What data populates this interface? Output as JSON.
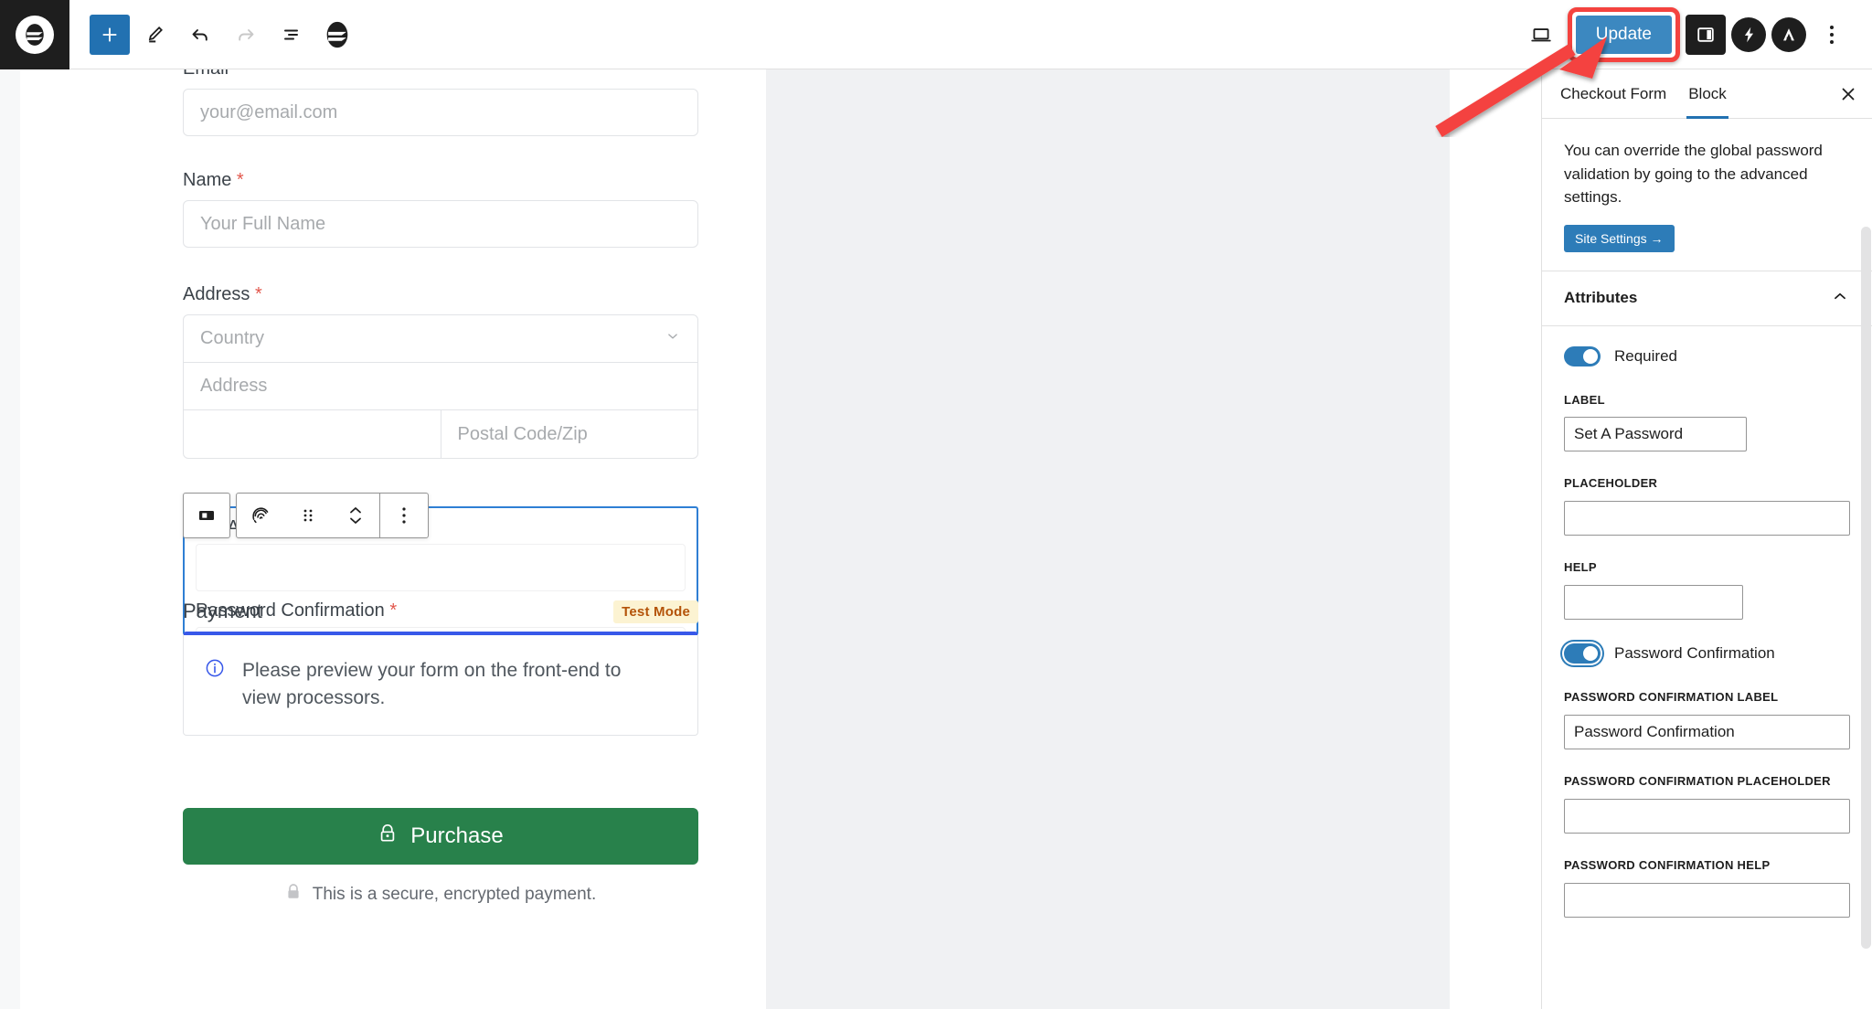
{
  "topbar": {
    "logo_icon": "wordpress-site-logo-icon",
    "buttons": [
      {
        "name": "add-block",
        "icon": "plus-icon",
        "label": ""
      },
      {
        "name": "tools",
        "icon": "pencil-icon",
        "label": ""
      },
      {
        "name": "undo",
        "icon": "undo-arrow-icon",
        "label": ""
      },
      {
        "name": "redo",
        "icon": "redo-arrow-icon",
        "label": ""
      },
      {
        "name": "list-view",
        "icon": "list-view-icon",
        "label": ""
      },
      {
        "name": "plugin-logo",
        "icon": "sureforms-logo-icon",
        "label": ""
      }
    ],
    "view_icon": "laptop-preview-icon",
    "update_label": "Update",
    "sidebar_toggle_icon": "settings-panel-icon",
    "plugin_icons": [
      "lightning-bolt-icon",
      "analytics-icon"
    ],
    "options_icon": "kebab-menu-icon"
  },
  "canvas": {
    "fields": [
      {
        "label": "Email",
        "required": false,
        "placeholder": "your@email.com"
      },
      {
        "label": "Name",
        "required": true,
        "placeholder": "Your Full Name"
      }
    ],
    "address": {
      "label": "Address",
      "required": true,
      "country_placeholder": "Country",
      "street_placeholder": "Address",
      "city_placeholder": "",
      "postal_placeholder": "Postal Code/Zip"
    },
    "block_toolbar": {
      "block_type_icon": "password-block-icon",
      "fingerprint_icon": "fingerprint-icon",
      "drag_icon": "drag-handle-icon",
      "movers_icon": "move-up-down-icon",
      "options_icon": "block-options-icon"
    },
    "selected_block": {
      "password_label": "Set A Password",
      "password_required": true,
      "confirm_label": "Password Confirmation",
      "confirm_required": true
    },
    "payment": {
      "title": "Payment",
      "badge": "Test Mode",
      "notice_icon": "info-circle-icon",
      "notice": "Please preview your form on the front-end to view processors."
    },
    "purchase": {
      "icon": "lock-icon",
      "label": "Purchase",
      "secure_icon": "padlock-icon",
      "secure_text": "This is a secure, encrypted payment."
    }
  },
  "sidebar": {
    "tabs": [
      {
        "label": "Checkout Form",
        "active": false
      },
      {
        "label": "Block",
        "active": true
      }
    ],
    "close_icon": "close-icon",
    "notice": "You can override the global password validation by going to the advanced settings.",
    "site_settings_label": "Site Settings →",
    "panel": {
      "title": "Attributes",
      "collapse_icon": "chevron-up-icon"
    },
    "required_toggle": {
      "label": "Required",
      "on": true
    },
    "label_field": {
      "label": "Label",
      "value": "Set A Password"
    },
    "placeholder_field": {
      "label": "Placeholder",
      "value": ""
    },
    "help_field": {
      "label": "Help",
      "value": ""
    },
    "confirm_toggle": {
      "label": "Password Confirmation",
      "on": true
    },
    "confirm_label_field": {
      "label": "Password Confirmation Label",
      "value": "Password Confirmation"
    },
    "confirm_placeholder_field": {
      "label": "Password Confirmation Placeholder",
      "value": ""
    },
    "confirm_help_field": {
      "label": "Password Confirmation Help",
      "value": ""
    }
  },
  "annotation": {
    "arrow_color": "#f4433f",
    "highlight_target": "Update"
  },
  "colors": {
    "accent": "#2271b1",
    "update_blue": "#3c88c0",
    "highlight_red": "#f4433f",
    "purchase_green": "#28814b",
    "badge_bg": "#fcf3d2",
    "badge_text": "#b45309",
    "selection_blue": "#2f7fd4",
    "required_red": "#e2574c"
  }
}
